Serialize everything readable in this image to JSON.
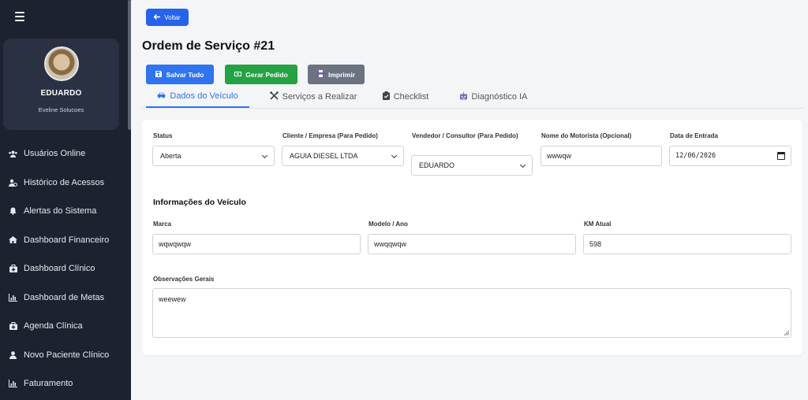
{
  "sidebar": {
    "profile": {
      "name": "EDUARDO",
      "company": "Eveline Solucoes"
    },
    "items": [
      {
        "label": "Usuários Online",
        "icon": "users-icon"
      },
      {
        "label": "Histórico de Acessos",
        "icon": "user-history-icon"
      },
      {
        "label": "Alertas do Sistema",
        "icon": "bell-icon"
      },
      {
        "label": "Dashboard Financeiro",
        "icon": "home-icon"
      },
      {
        "label": "Dashboard Clínico",
        "icon": "medkit-icon"
      },
      {
        "label": "Dashboard de Metas",
        "icon": "chart-bar-icon"
      },
      {
        "label": "Agenda Clínica",
        "icon": "medkit-icon"
      },
      {
        "label": "Novo Paciente Clínico",
        "icon": "user-icon"
      },
      {
        "label": "Faturamento",
        "icon": "chart-bar-icon"
      }
    ]
  },
  "toolbar": {
    "back_label": "Voltar",
    "save_label": "Salvar Tudo",
    "order_label": "Gerar Pedido",
    "print_label": "Imprimir"
  },
  "page": {
    "title": "Ordem de Serviço #21"
  },
  "tabs": [
    {
      "label": "Dados do Veículo",
      "active": true
    },
    {
      "label": "Serviços a Realizar",
      "active": false
    },
    {
      "label": "Checklist",
      "active": false
    },
    {
      "label": "Diagnóstico IA",
      "active": false
    }
  ],
  "form": {
    "status": {
      "label": "Status",
      "value": "Aberta"
    },
    "client": {
      "label": "Cliente / Empresa (Para Pedido)",
      "value": "AGUIA DIESEL LTDA"
    },
    "seller": {
      "label": "Vendedor / Consultor (Para Pedido)",
      "value": "EDUARDO"
    },
    "driver": {
      "label": "Nome do Motorista (Opcional)",
      "value": "wwwqw"
    },
    "entry_date": {
      "label": "Data de Entrada",
      "value": "12/06/2026"
    },
    "vehicle_section": "Informações do Veículo",
    "brand": {
      "label": "Marca",
      "value": "wqwqwqw"
    },
    "model": {
      "label": "Modelo / Ano",
      "value": "wwqqwqw"
    },
    "km": {
      "label": "KM Atual",
      "value": "598"
    },
    "notes": {
      "label": "Observações Gerais",
      "value": "weewew"
    }
  },
  "colors": {
    "primary": "#2f74f0",
    "success": "#25a244",
    "secondary": "#6b7280",
    "sidebar": "#1c2230"
  }
}
